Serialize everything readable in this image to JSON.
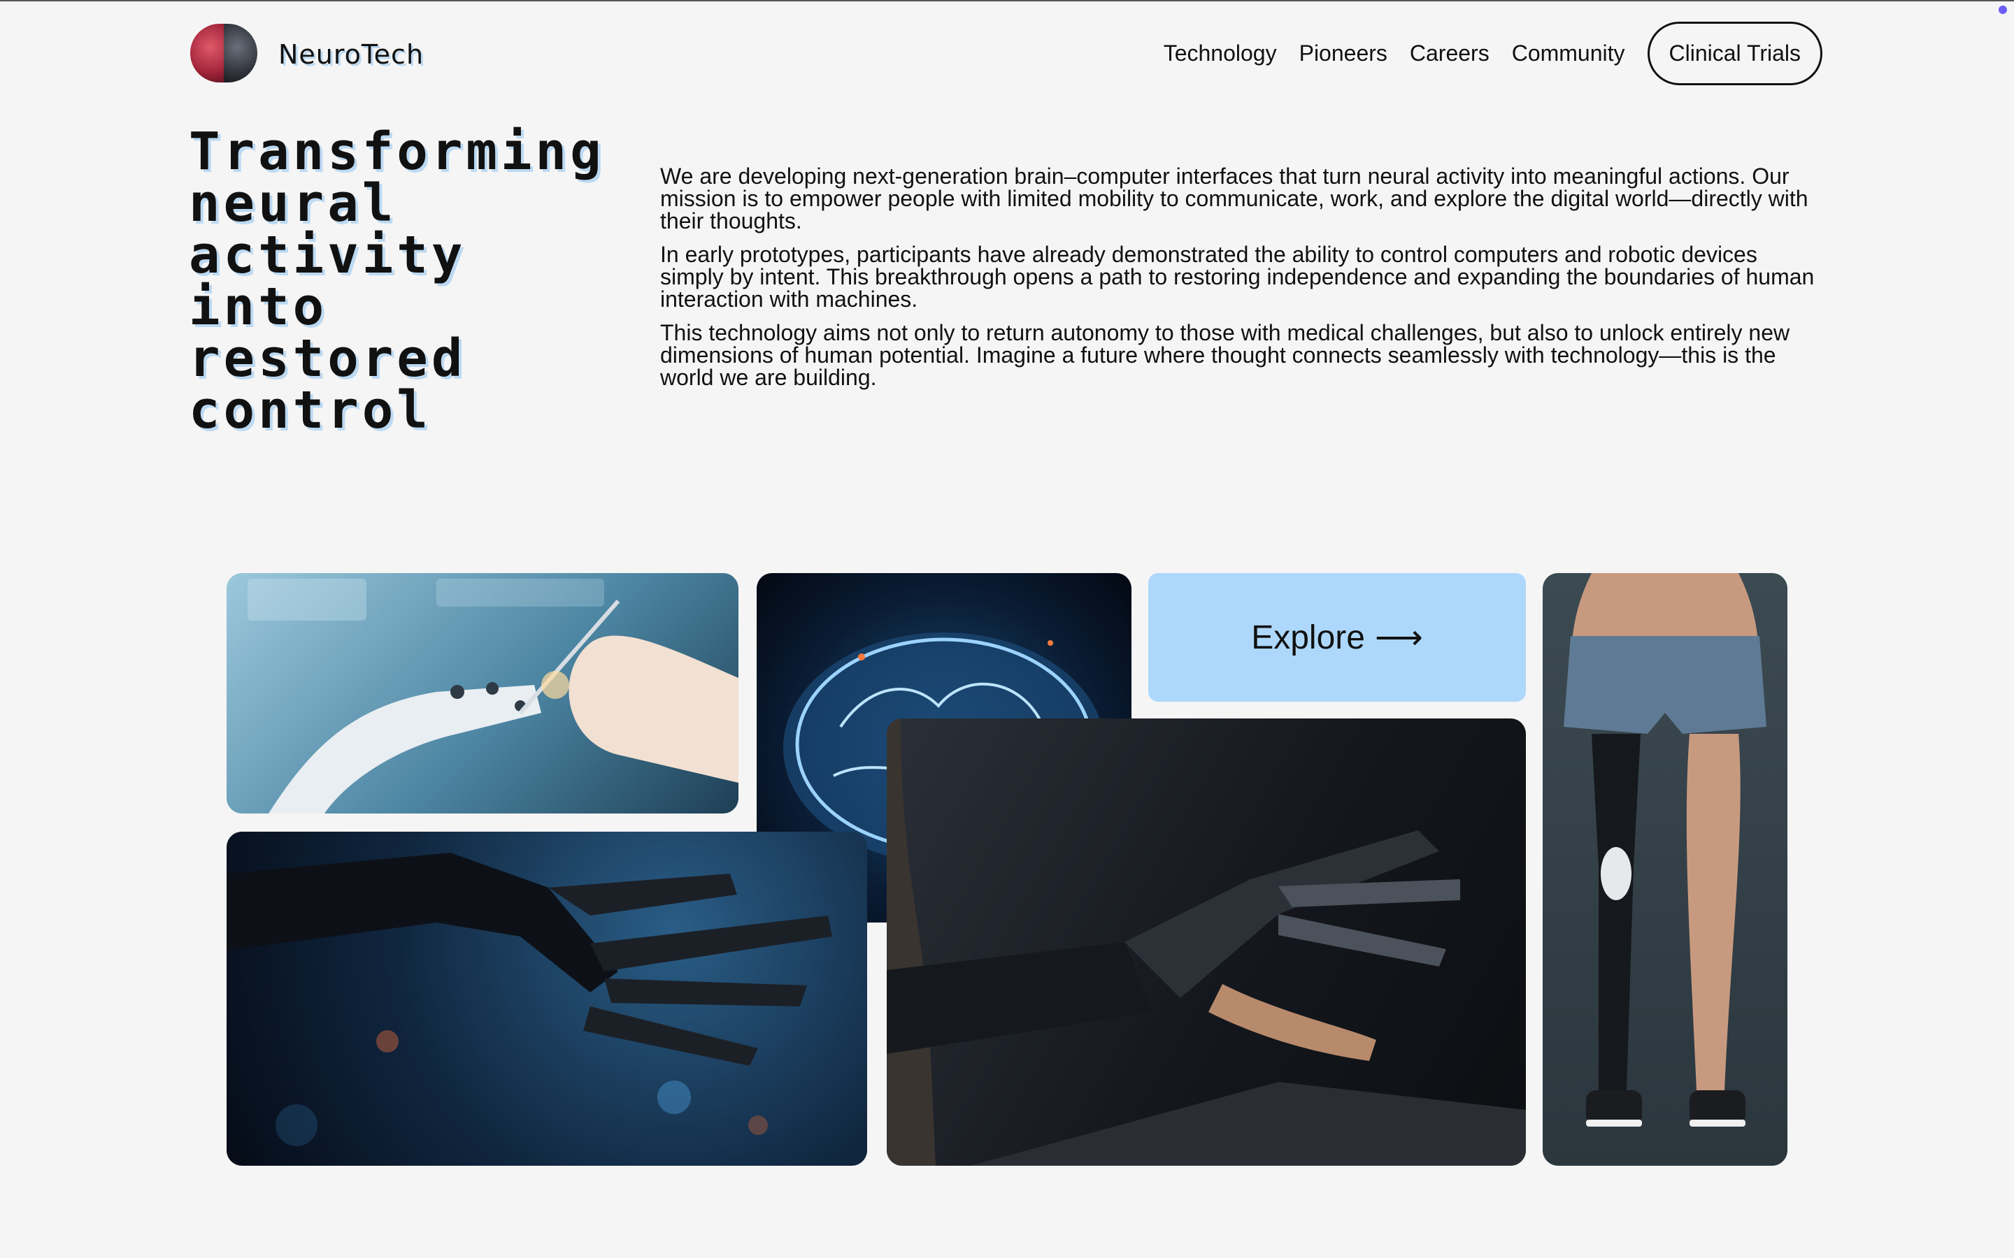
{
  "brand": {
    "name": "NeuroTech"
  },
  "nav": {
    "items": [
      "Technology",
      "Pioneers",
      "Careers",
      "Community"
    ],
    "cta": "Clinical Trials"
  },
  "hero": {
    "title_lines": [
      "Transforming",
      "neural",
      "activity into",
      "restored",
      "control"
    ],
    "paragraphs": [
      "We are developing next-generation brain–computer interfaces that turn neural activity into meaningful actions. Our mission is to empower people with limited mobility to communicate, work, and explore the digital world—directly with their thoughts.",
      "In early prototypes, participants have already demonstrated the ability to control computers and robotic devices simply by intent. This breakthrough opens a path to restoring independence and expanding the boundaries of human interaction with machines.",
      "This technology aims not only to return autonomy to those with medical challenges, but also to unlock entirely new dimensions of human potential. Imagine a future where thought connects seamlessly with technology—this is the world we are building."
    ]
  },
  "gallery": {
    "explore_label": "Explore",
    "explore_arrow": "⟶",
    "accent_color": "#add8fb"
  },
  "icons": {
    "logo": "brain-logo-icon",
    "explore": "arrow-right-icon"
  }
}
